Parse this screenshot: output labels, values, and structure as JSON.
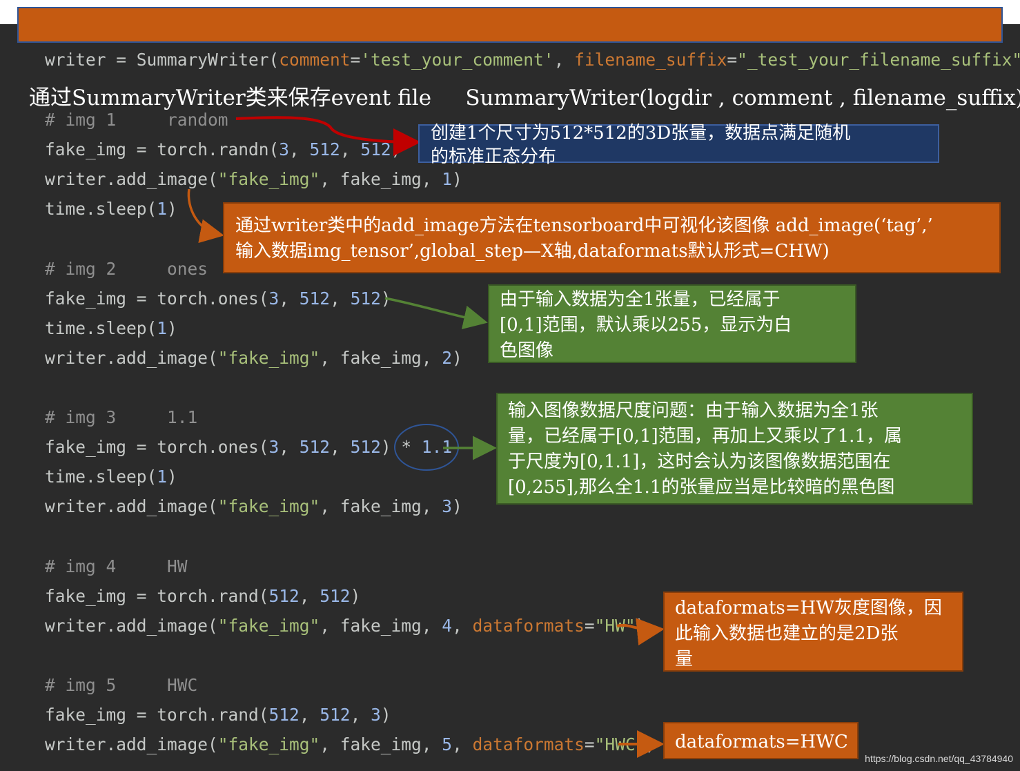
{
  "title": "通过SummaryWriter类来保存event file     SummaryWriter(logdir , comment , filename_suffix)",
  "code": {
    "writer_line": {
      "a": "writer = SummaryWriter(",
      "kw1": "comment",
      "b": "=",
      "s1": "'test_your_comment'",
      "c": ", ",
      "kw2": "filename_suffix",
      "d": "=",
      "s2": "\"_test_your_filename_suffix\"",
      "e": ")"
    },
    "blocks": [
      {
        "comment": "# img 1     random",
        "lines": [
          [
            "fake_img = torch.randn(",
            "3",
            ", ",
            "512",
            ", ",
            "512",
            ")"
          ],
          [
            "writer.add_image(",
            "\"fake_img\"",
            ", fake_img, ",
            "1",
            ")"
          ],
          [
            "time.sleep(",
            "1",
            ")"
          ]
        ]
      },
      {
        "comment": "# img 2     ones",
        "lines": [
          [
            "fake_img = torch.ones(",
            "3",
            ", ",
            "512",
            ", ",
            "512",
            ")"
          ],
          [
            "time.sleep(",
            "1",
            ")"
          ],
          [
            "writer.add_image(",
            "\"fake_img\"",
            ", fake_img, ",
            "2",
            ")"
          ]
        ]
      },
      {
        "comment": "# img 3     1.1",
        "lines": [
          [
            "fake_img = torch.ones(",
            "3",
            ", ",
            "512",
            ", ",
            "512",
            ") * ",
            "1.1"
          ],
          [
            "time.sleep(",
            "1",
            ")"
          ],
          [
            "writer.add_image(",
            "\"fake_img\"",
            ", fake_img, ",
            "3",
            ")"
          ]
        ]
      },
      {
        "comment": "# img 4     HW",
        "lines": [
          [
            "fake_img = torch.rand(",
            "512",
            ", ",
            "512",
            ")"
          ],
          [
            "writer.add_image(",
            "\"fake_img\"",
            ", fake_img, ",
            "4",
            ", ",
            "dataformats",
            "=",
            "\"HW\"",
            ")"
          ]
        ]
      },
      {
        "comment": "# img 5     HWC",
        "lines": [
          [
            "fake_img = torch.rand(",
            "512",
            ", ",
            "512",
            ", ",
            "3",
            ")"
          ],
          [
            "writer.add_image(",
            "\"fake_img\"",
            ", fake_img, ",
            "5",
            ", ",
            "dataformats",
            "=",
            "\"HWC\"",
            ")"
          ]
        ]
      }
    ]
  },
  "notes": {
    "randn": [
      "创建1个尺寸为512*512的3D张量，数据点满足随机",
      "的标准正态分布"
    ],
    "add_image": [
      "通过writer类中的add_image方法在tensorboard中可视化该图像   add_image(‘tag’,’",
      "输入数据img_tensor’,global_step—X轴,dataformats默认形式=CHW)"
    ],
    "ones": [
      "由于输入数据为全1张量，已经属于",
      "[0,1]范围，默认乘以255，显示为白",
      "色图像"
    ],
    "scale": [
      "输入图像数据尺度问题：由于输入数据为全1张",
      "量，已经属于[0,1]范围，再加上又乘以了1.1，属",
      "于尺度为[0,1.1]，这时会认为该图像数据范围在",
      "[0,255],那么全1.1的张量应当是比较暗的黑色图"
    ],
    "hw": [
      "dataformats=HW灰度图像，因",
      "此输入数据也建立的是2D张",
      "量"
    ],
    "hwc": [
      "dataformats=HWC"
    ]
  },
  "watermark": "https://blog.csdn.net/qq_43784940",
  "colors": {
    "editor_bg": "#2b2b2b",
    "orange_note": "#c55a11",
    "blue_note": "#1f3864",
    "green_note": "#548235",
    "red_arrow": "#c00000"
  }
}
